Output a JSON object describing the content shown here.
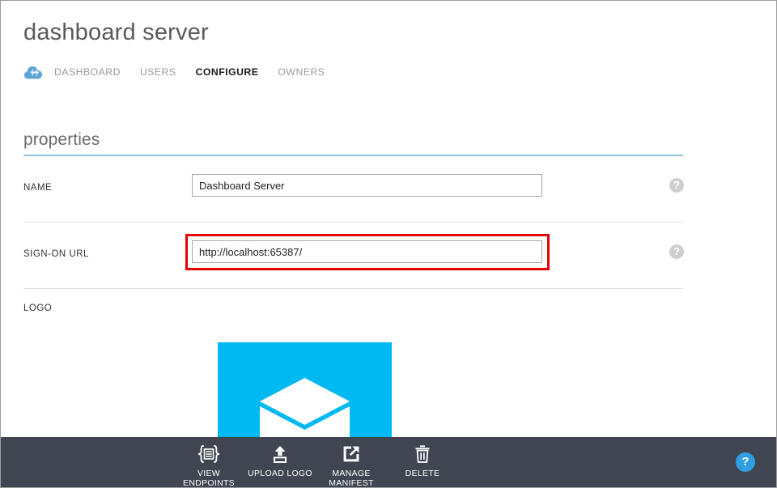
{
  "header": {
    "title": "dashboard server",
    "logo_icon": "cloud-bolt-icon",
    "tabs": [
      {
        "label": "DASHBOARD",
        "active": false
      },
      {
        "label": "USERS",
        "active": false
      },
      {
        "label": "CONFIGURE",
        "active": true
      },
      {
        "label": "OWNERS",
        "active": false
      }
    ]
  },
  "properties": {
    "section_title": "properties",
    "accent_color": "#94c2e3",
    "fields": [
      {
        "label": "NAME",
        "value": "Dashboard Server",
        "placeholder": "",
        "help": "?",
        "highlighted": false
      },
      {
        "label": "SIGN-ON URL",
        "value": "http://localhost:65387/",
        "placeholder": "",
        "help": "?",
        "highlighted": true
      }
    ],
    "logo": {
      "label": "LOGO",
      "image_name": "app-logo-cube-image",
      "background_color": "#00b9f2",
      "shape_color": "#ffffff"
    },
    "highlight_color": "#e50000"
  },
  "commandbar": {
    "background_color": "#3f4651",
    "items": [
      {
        "label": "VIEW ENDPOINTS",
        "icon": "braces-list-icon"
      },
      {
        "label": "UPLOAD LOGO",
        "icon": "upload-icon"
      },
      {
        "label": "MANAGE\nMANIFEST",
        "icon": "external-link-icon"
      },
      {
        "label": "DELETE",
        "icon": "trash-icon"
      }
    ],
    "help_button": {
      "label": "?",
      "icon": "question-icon",
      "color": "#2e9fe0"
    }
  }
}
